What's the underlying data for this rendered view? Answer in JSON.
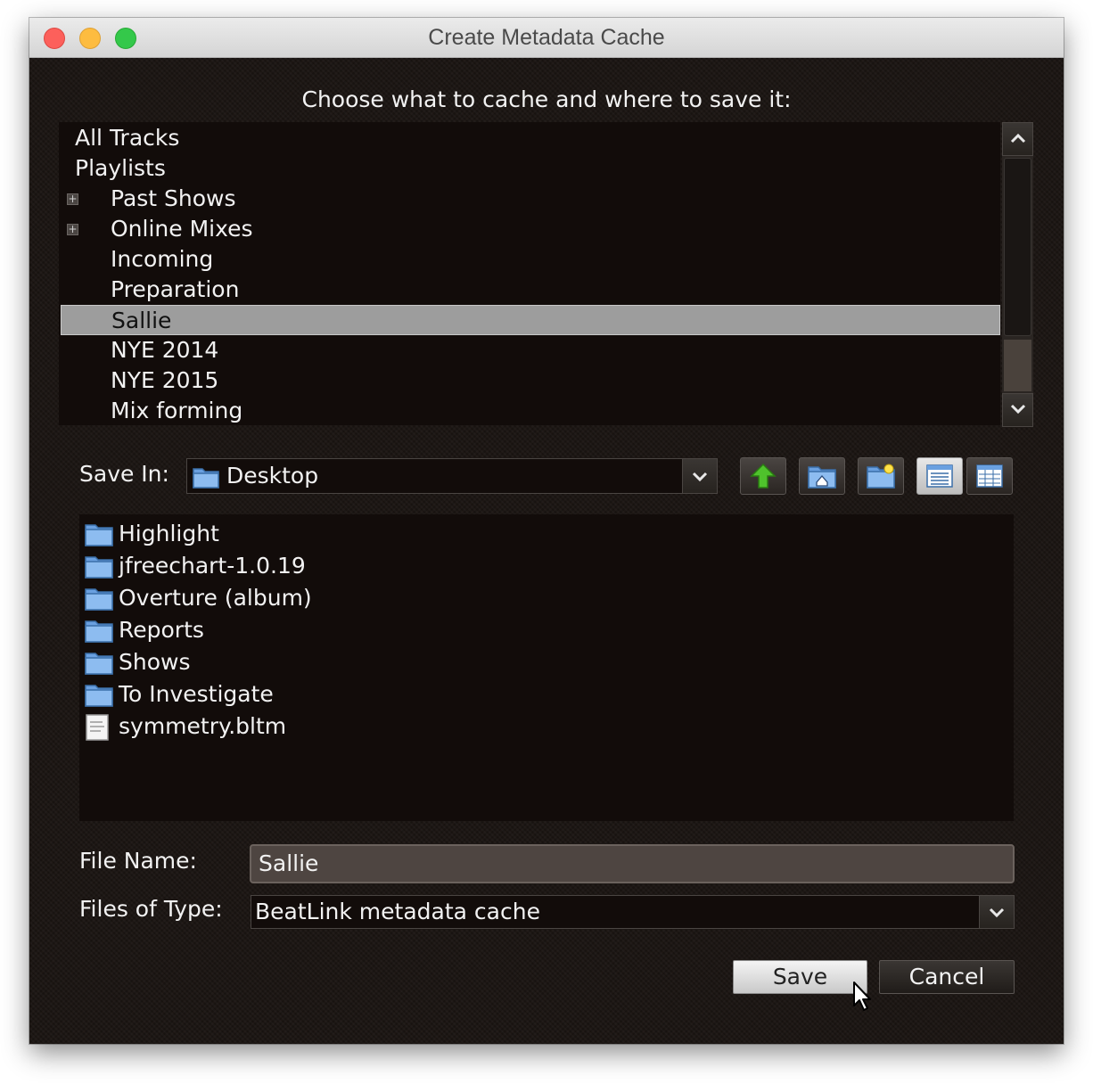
{
  "window": {
    "title": "Create Metadata Cache"
  },
  "heading": "Choose what to cache and where to save it:",
  "tree": {
    "items": [
      {
        "label": "All Tracks",
        "level": 0,
        "expandable": false,
        "selected": false
      },
      {
        "label": "Playlists",
        "level": 0,
        "expandable": false,
        "selected": false
      },
      {
        "label": "Past Shows",
        "level": 1,
        "expandable": true,
        "selected": false
      },
      {
        "label": "Online Mixes",
        "level": 1,
        "expandable": true,
        "selected": false
      },
      {
        "label": "Incoming",
        "level": 1,
        "expandable": false,
        "selected": false
      },
      {
        "label": "Preparation",
        "level": 1,
        "expandable": false,
        "selected": false
      },
      {
        "label": "Sallie",
        "level": 1,
        "expandable": false,
        "selected": true
      },
      {
        "label": "NYE 2014",
        "level": 1,
        "expandable": false,
        "selected": false
      },
      {
        "label": "NYE 2015",
        "level": 1,
        "expandable": false,
        "selected": false
      },
      {
        "label": "Mix forming",
        "level": 1,
        "expandable": false,
        "selected": false
      }
    ]
  },
  "save_in": {
    "label": "Save In:",
    "value": "Desktop"
  },
  "toolbar": {
    "buttons": [
      {
        "name": "up-one-level-button",
        "icon": "up-arrow-icon"
      },
      {
        "name": "home-button",
        "icon": "home-folder-icon"
      },
      {
        "name": "new-folder-button",
        "icon": "new-folder-icon"
      },
      {
        "name": "list-view-button",
        "icon": "list-view-icon",
        "active": true
      },
      {
        "name": "details-view-button",
        "icon": "details-view-icon",
        "active": false
      }
    ]
  },
  "files": [
    {
      "name": "Highlight",
      "type": "folder"
    },
    {
      "name": "jfreechart-1.0.19",
      "type": "folder"
    },
    {
      "name": "Overture (album)",
      "type": "folder"
    },
    {
      "name": "Reports",
      "type": "folder"
    },
    {
      "name": "Shows",
      "type": "folder"
    },
    {
      "name": "To Investigate",
      "type": "folder"
    },
    {
      "name": "symmetry.bltm",
      "type": "file"
    }
  ],
  "file_name": {
    "label": "File Name:",
    "value": "Sallie"
  },
  "file_type": {
    "label": "Files of Type:",
    "value": "BeatLink metadata cache"
  },
  "buttons": {
    "save": "Save",
    "cancel": "Cancel"
  }
}
